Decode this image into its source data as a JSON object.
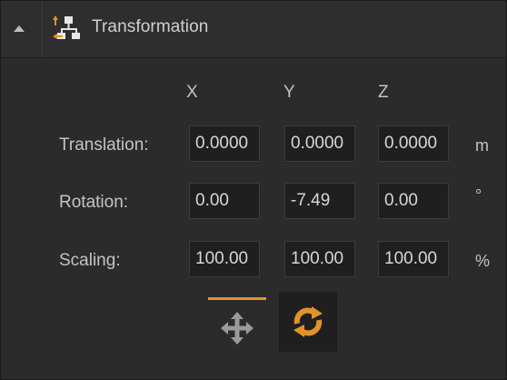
{
  "header": {
    "title": "Transformation",
    "collapse_icon": "triangle-up-icon",
    "section_icon": "hierarchy-icon"
  },
  "columns": [
    "X",
    "Y",
    "Z"
  ],
  "rows": [
    {
      "label": "Translation:",
      "values": [
        "0.0000",
        "0.0000",
        "0.0000"
      ],
      "unit": "m"
    },
    {
      "label": "Rotation:",
      "values": [
        "0.00",
        "-7.49",
        "0.00"
      ],
      "unit": "°"
    },
    {
      "label": "Scaling:",
      "values": [
        "100.00",
        "100.00",
        "100.00"
      ],
      "unit": "%"
    }
  ],
  "tools": {
    "move_icon": "move-arrows-icon",
    "refresh_icon": "refresh-icon",
    "accent_color": "#e0932a"
  }
}
